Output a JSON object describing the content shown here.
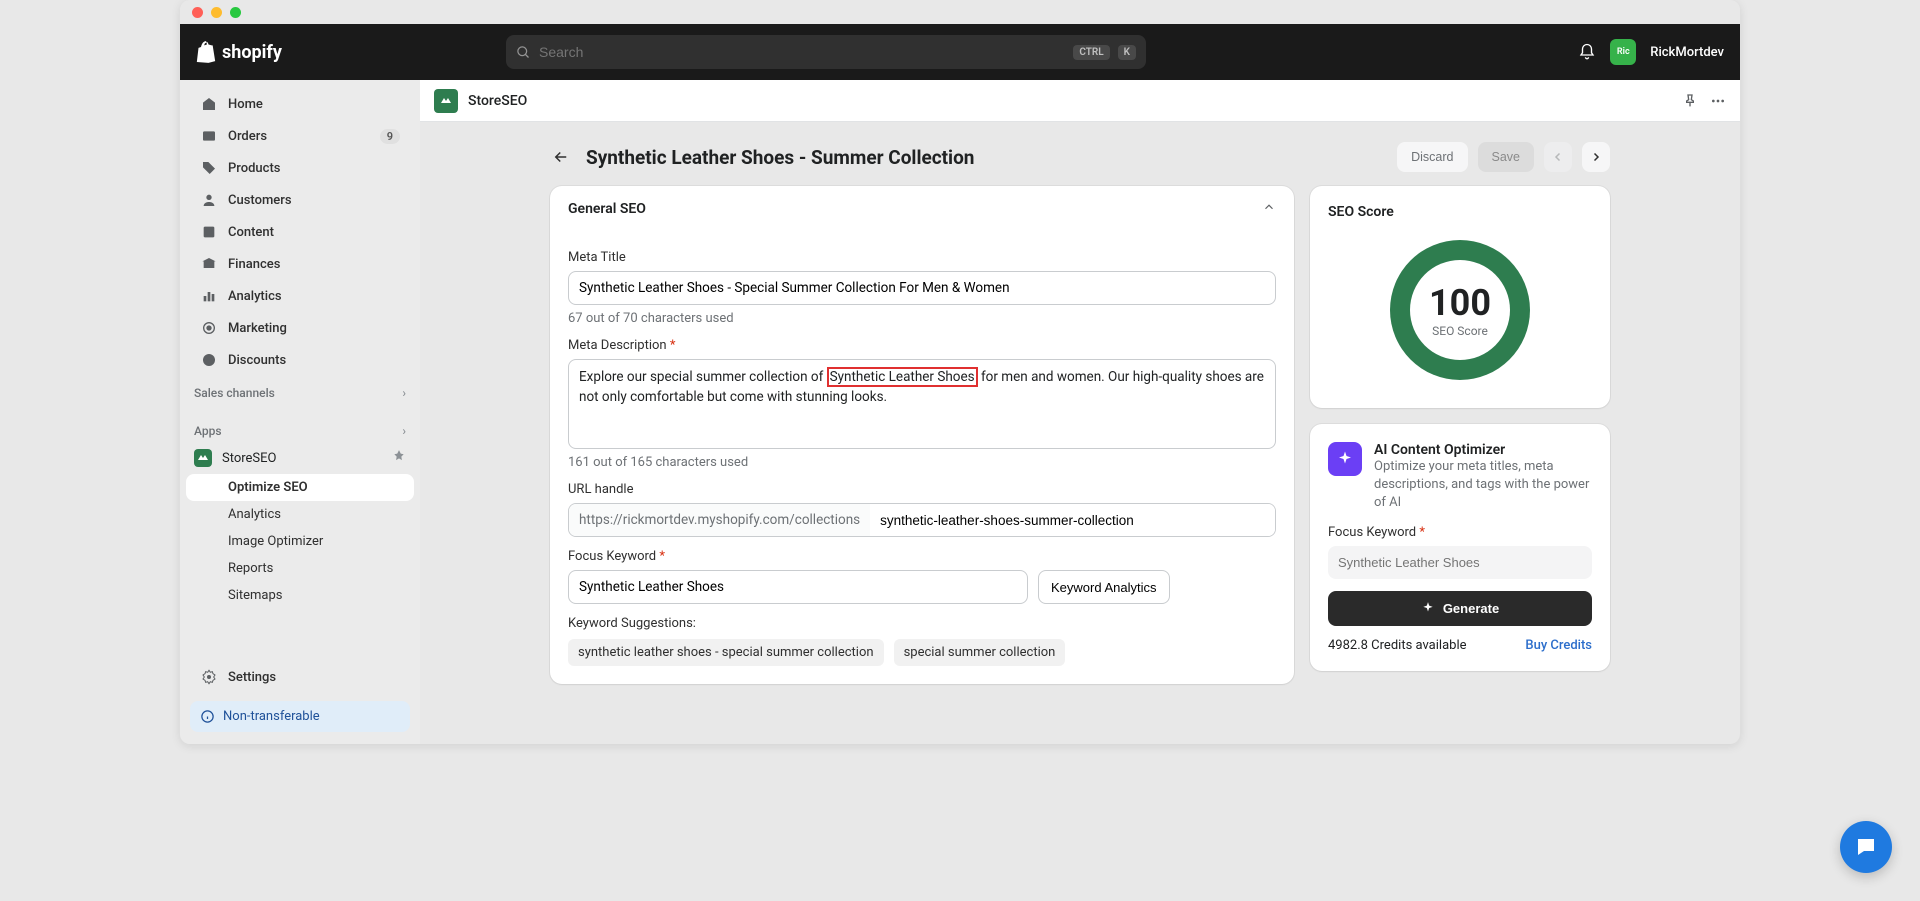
{
  "topbar": {
    "brand": "shopify",
    "search_placeholder": "Search",
    "kbd1": "CTRL",
    "kbd2": "K",
    "avatar_initials": "Ric",
    "username": "RickMortdev"
  },
  "sidebar": {
    "items": [
      {
        "label": "Home"
      },
      {
        "label": "Orders",
        "badge": "9"
      },
      {
        "label": "Products"
      },
      {
        "label": "Customers"
      },
      {
        "label": "Content"
      },
      {
        "label": "Finances"
      },
      {
        "label": "Analytics"
      },
      {
        "label": "Marketing"
      },
      {
        "label": "Discounts"
      }
    ],
    "channels_heading": "Sales channels",
    "apps_heading": "Apps",
    "apps": {
      "storeseo": "StoreSEO",
      "sub": [
        {
          "label": "Optimize SEO",
          "active": true
        },
        {
          "label": "Analytics"
        },
        {
          "label": "Image Optimizer"
        },
        {
          "label": "Reports"
        },
        {
          "label": "Sitemaps"
        }
      ]
    },
    "settings": "Settings",
    "nontransferable": "Non-transferable"
  },
  "app_header": {
    "title": "StoreSEO"
  },
  "page": {
    "title": "Synthetic Leather Shoes - Summer Collection",
    "discard": "Discard",
    "save": "Save"
  },
  "general_seo": {
    "heading": "General SEO",
    "meta_title_label": "Meta Title",
    "meta_title": "Synthetic Leather Shoes - Special Summer Collection For Men & Women",
    "meta_title_helper": "67 out of 70 characters used",
    "meta_desc_label": "Meta Description",
    "meta_desc_pre": "Explore our special summer collection of ",
    "meta_desc_hl": "Synthetic Leather Shoes",
    "meta_desc_post": " for men and women. Our high-quality shoes are not only comfortable but come with stunning looks.",
    "meta_desc_helper": "161 out of 165 characters used",
    "url_label": "URL handle",
    "url_prefix": "https://rickmortdev.myshopify.com/collections",
    "url_slug": "synthetic-leather-shoes-summer-collection",
    "focus_label": "Focus Keyword",
    "focus_value": "Synthetic Leather Shoes",
    "kw_analytics": "Keyword Analytics",
    "suggestions_label": "Keyword Suggestions:",
    "chips": [
      "synthetic leather shoes - special summer collection",
      "special summer collection"
    ]
  },
  "seo_score": {
    "heading": "SEO Score",
    "score": "100",
    "label": "SEO Score"
  },
  "ai": {
    "title": "AI Content Optimizer",
    "desc": "Optimize your meta titles, meta descriptions, and tags with the power of AI",
    "focus_label": "Focus Keyword",
    "focus_placeholder": "Synthetic Leather Shoes",
    "generate": "Generate",
    "credits": "4982.8 Credits available",
    "buy": "Buy Credits"
  }
}
